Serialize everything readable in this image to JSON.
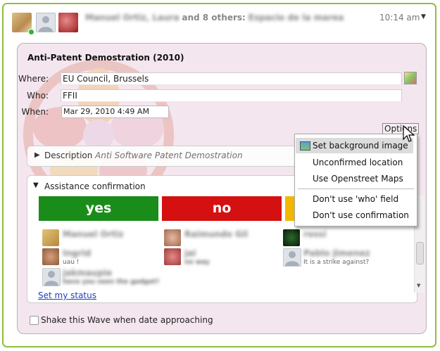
{
  "header": {
    "participants_names": "Manuel Ortiz, Laura",
    "and_others": "and 8 others:",
    "wave_subject": "Espacio de la marea",
    "timestamp": "10:14 am",
    "caret": "▼"
  },
  "event": {
    "title": "Anti-Patent Demostration (2010)",
    "where_label": "Where:",
    "where_value": "EU Council, Brussels",
    "who_label": "Who:",
    "who_value": "FFII",
    "when_label": "When:",
    "when_value": "Mar 29, 2010 4:49 AM",
    "options_label": "Options"
  },
  "description": {
    "label": "Description",
    "value": "Anti Software Patent Demostration"
  },
  "assistance": {
    "label": "Assistance confirmation",
    "yes_label": "yes",
    "no_label": "no",
    "people": [
      {
        "name": "Manuel Ortiz",
        "note": ""
      },
      {
        "name": "Raimundo Gil",
        "note": ""
      },
      {
        "name": "rossi",
        "note": ""
      },
      {
        "name": "Ingrid",
        "note": "uau !"
      },
      {
        "name": "jai",
        "note": "no way"
      },
      {
        "name": "Pablo Jimenez",
        "note": "It is a strike against?"
      },
      {
        "name": "jakmaupie",
        "note": "have you seen the gadget?"
      }
    ],
    "set_status": "Set my status"
  },
  "shake": {
    "label": "Shake this Wave when date approaching"
  },
  "options_menu": {
    "items": [
      "Set background image",
      "Unconfirmed location",
      "Use Openstreet Maps",
      "Don't use 'who' field",
      "Don't use confirmation"
    ]
  },
  "colors": {
    "frame": "#8fbf3f",
    "yes": "#1a8c1a",
    "no": "#d41010",
    "maybe": "#f2b700",
    "gadget_bg": "#f4e6ee",
    "link": "#1f3fbf"
  },
  "icons": [
    "chevron-down-icon",
    "map-icon",
    "triangle-right-icon",
    "triangle-down-icon",
    "image-icon",
    "cursor-icon"
  ]
}
